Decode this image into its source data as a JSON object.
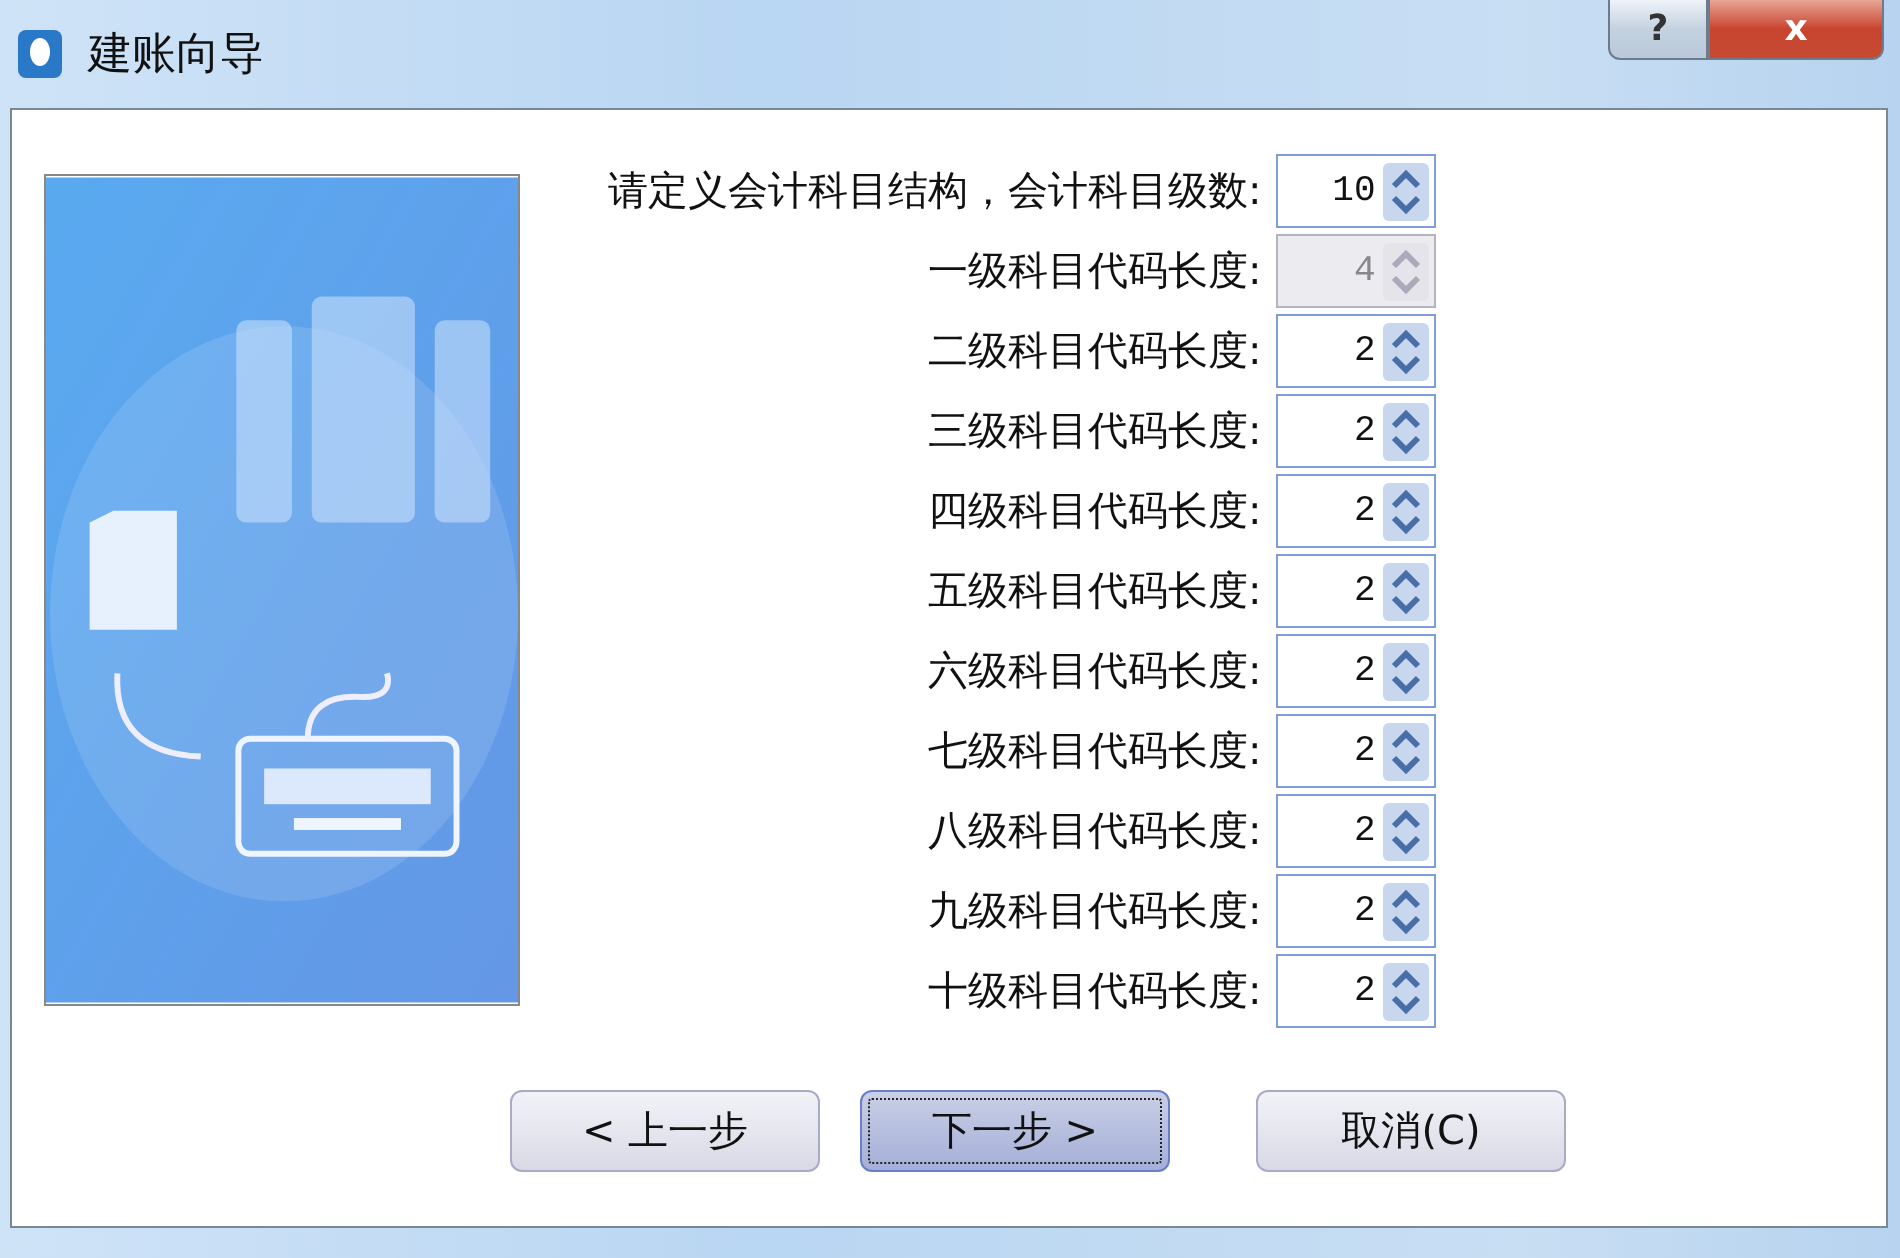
{
  "window": {
    "title": "建账向导",
    "help": "?",
    "close": "x"
  },
  "structure": {
    "label": "请定义会计科目结构，会计科目级数:",
    "value": "10",
    "disabled": false
  },
  "levels": [
    {
      "label": "一级科目代码长度:",
      "value": "4",
      "disabled": true
    },
    {
      "label": "二级科目代码长度:",
      "value": "2",
      "disabled": false
    },
    {
      "label": "三级科目代码长度:",
      "value": "2",
      "disabled": false
    },
    {
      "label": "四级科目代码长度:",
      "value": "2",
      "disabled": false
    },
    {
      "label": "五级科目代码长度:",
      "value": "2",
      "disabled": false
    },
    {
      "label": "六级科目代码长度:",
      "value": "2",
      "disabled": false
    },
    {
      "label": "七级科目代码长度:",
      "value": "2",
      "disabled": false
    },
    {
      "label": "八级科目代码长度:",
      "value": "2",
      "disabled": false
    },
    {
      "label": "九级科目代码长度:",
      "value": "2",
      "disabled": false
    },
    {
      "label": "十级科目代码长度:",
      "value": "2",
      "disabled": false
    }
  ],
  "buttons": [
    {
      "label": "< 上一步",
      "focused": false
    },
    {
      "label": "下一步 >",
      "focused": true
    },
    {
      "label": "取消(C)",
      "focused": false
    }
  ]
}
